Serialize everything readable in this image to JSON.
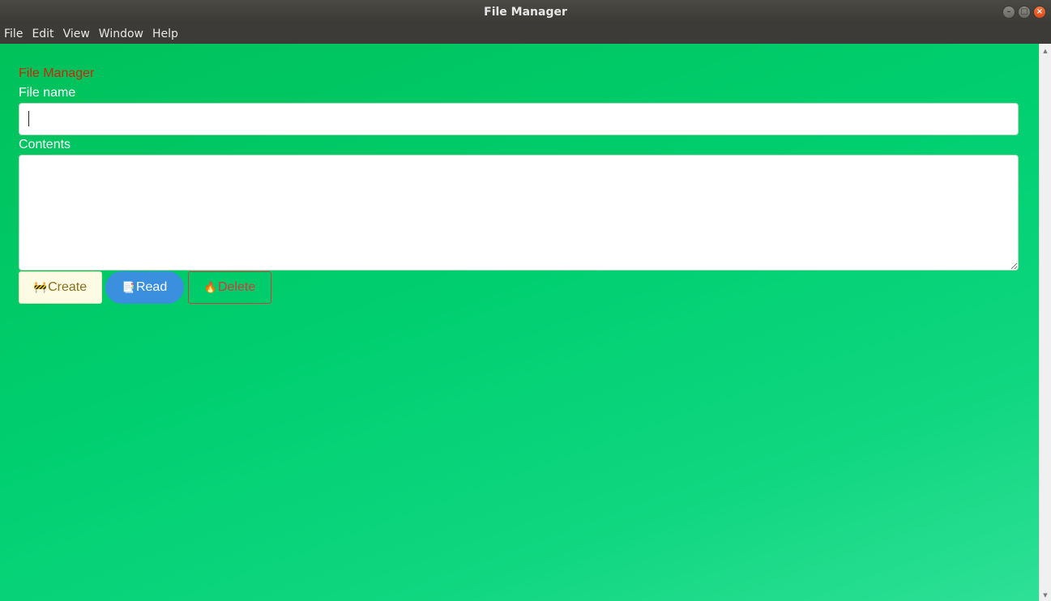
{
  "window": {
    "title": "File Manager",
    "buttons": [
      {
        "name": "minimize",
        "glyph": "–"
      },
      {
        "name": "maximize",
        "glyph": "□"
      },
      {
        "name": "close",
        "glyph": "×"
      }
    ]
  },
  "menubar": {
    "items": [
      "File",
      "Edit",
      "View",
      "Window",
      "Help"
    ]
  },
  "form": {
    "heading": "File Manager",
    "filename_label": "File name",
    "filename_value": "",
    "contents_label": "Contents",
    "contents_value": ""
  },
  "actions": {
    "create": {
      "icon": "🚧",
      "label": "Create"
    },
    "read": {
      "icon": "📑",
      "label": "Read"
    },
    "delete": {
      "icon": "🔥",
      "label": "Delete"
    }
  },
  "colors": {
    "heading": "#c8290a",
    "read_button": "#3b8fdf",
    "delete_button": "#d43a3a",
    "create_button_bg": "#fdfbe3",
    "background_start": "#00c15a",
    "background_end": "#2ee096"
  }
}
